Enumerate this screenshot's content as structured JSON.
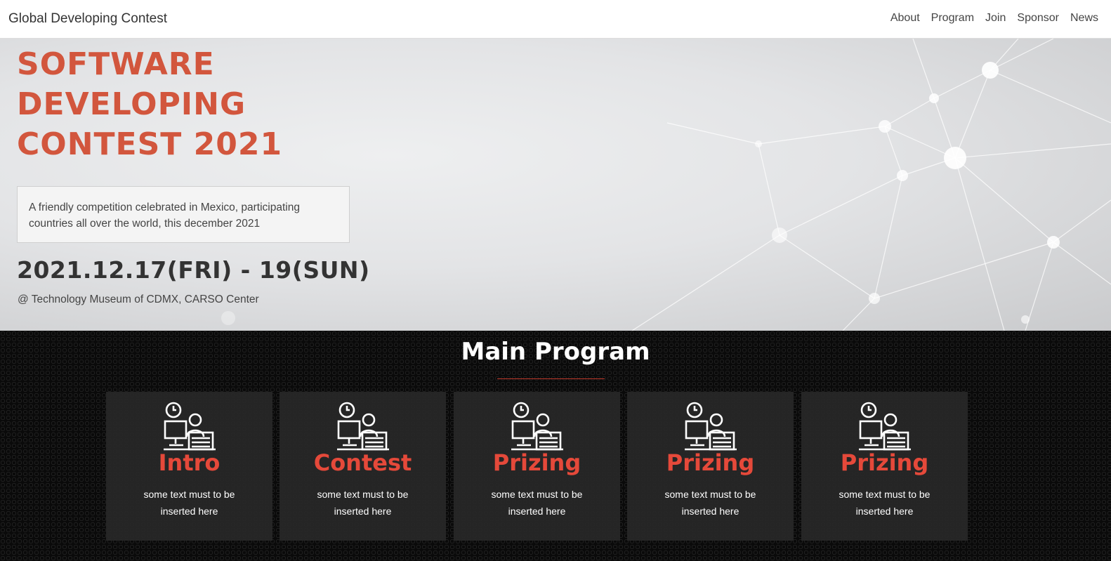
{
  "nav": {
    "brand": "Global Developing Contest",
    "links": [
      "About",
      "Program",
      "Join",
      "Sponsor",
      "News"
    ]
  },
  "hero": {
    "title_lines": [
      "SOFTWARE",
      "DEVELOPING",
      "CONTEST 2021"
    ],
    "description": "A friendly competition celebrated in Mexico, participating countries all over the world, this december 2021",
    "date": "2021.12.17(FRI) - 19(SUN)",
    "venue": "@ Technology Museum of CDMX, CARSO Center"
  },
  "program": {
    "title": "Main Program",
    "cards": [
      {
        "title": "Intro",
        "text": "some text must to be inserted here",
        "icon": "developer-at-desk-icon"
      },
      {
        "title": "Contest",
        "text": "some text must to be inserted here",
        "icon": "developer-at-desk-icon"
      },
      {
        "title": "Prizing",
        "text": "some text must to be inserted here",
        "icon": "developer-at-desk-icon"
      },
      {
        "title": "Prizing",
        "text": "some text must to be inserted here",
        "icon": "developer-at-desk-icon"
      },
      {
        "title": "Prizing",
        "text": "some text must to be inserted here",
        "icon": "developer-at-desk-icon"
      }
    ]
  },
  "colors": {
    "accent": "#e5493a",
    "hero_title": "#d2563d",
    "program_bg": "#0a0a0a"
  }
}
